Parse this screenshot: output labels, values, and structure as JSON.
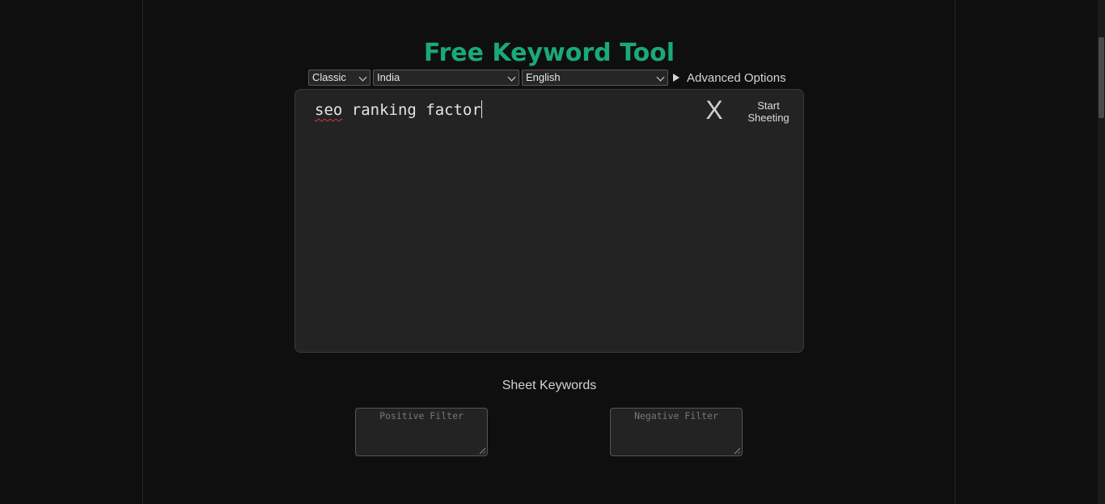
{
  "header": {
    "title": "Free Keyword Tool"
  },
  "controls": {
    "mode": "Classic",
    "country": "India",
    "language": "English",
    "advanced_label": "Advanced Options"
  },
  "editor": {
    "text_misspelled": "seo",
    "text_rest": " ranking factor",
    "clear_label": "X",
    "start_label_line1": "Start",
    "start_label_line2": "Sheeting"
  },
  "sheet": {
    "heading": "Sheet Keywords",
    "positive_placeholder": "Positive Filter",
    "negative_placeholder": "Negative Filter"
  },
  "colors": {
    "accent": "#1aa97a",
    "background": "#0f0f0f",
    "panel": "#232323"
  }
}
